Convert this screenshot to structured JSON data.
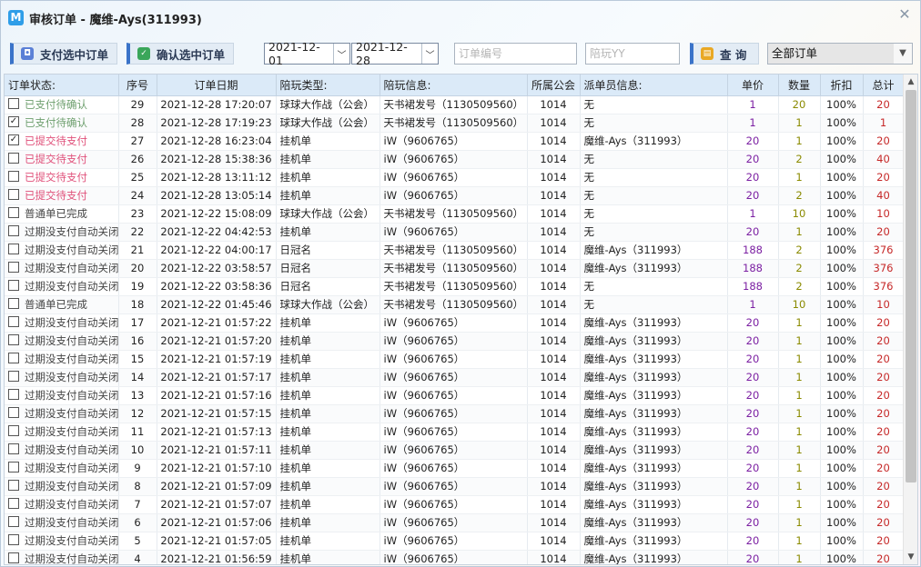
{
  "window": {
    "title": "审核订单 - 魔维-Ays(311993)",
    "app_icon": "M",
    "close_label": "✕"
  },
  "toolbar": {
    "pay_button": "支付选中订单",
    "confirm_button": "确认选中订单",
    "start_date": "2021-12-01",
    "end_date": "2021-12-28",
    "order_no_placeholder": "订单编号",
    "yy_placeholder": "陪玩YY",
    "search_button": "查 询",
    "filter_value": "全部订单"
  },
  "colors": {
    "accent": "#3a73c9",
    "unit_price": "#7b1fa2",
    "quantity": "#8a8a00",
    "total": "#c62828",
    "pending_confirm": "#6fa06f",
    "pending_pay": "#e0507a"
  },
  "table": {
    "headers": [
      "订单状态:",
      "序号",
      "订单日期",
      "陪玩类型:",
      "陪玩信息:",
      "所属公会",
      "派单员信息:",
      "单价",
      "数量",
      "折扣",
      "总计"
    ],
    "rows": [
      {
        "checked": false,
        "status": "已支付待确认",
        "status_color": "#6fa06f",
        "seq": "29",
        "date": "2021-12-28 17:20:07",
        "type": "球球大作战（公会）",
        "info": "天书裙发号（1130509560）",
        "guild": "1014",
        "dispatcher": "无",
        "price": "1",
        "qty": "20",
        "discount": "100%",
        "total": "20"
      },
      {
        "checked": true,
        "status": "已支付待确认",
        "status_color": "#6fa06f",
        "seq": "28",
        "date": "2021-12-28 17:19:23",
        "type": "球球大作战（公会）",
        "info": "天书裙发号（1130509560）",
        "guild": "1014",
        "dispatcher": "无",
        "price": "1",
        "qty": "1",
        "discount": "100%",
        "total": "1"
      },
      {
        "checked": true,
        "status": "已提交待支付",
        "status_color": "#e0507a",
        "seq": "27",
        "date": "2021-12-28 16:23:04",
        "type": "挂机单",
        "info": "iW（9606765）",
        "guild": "1014",
        "dispatcher": "魔维-Ays（311993）",
        "price": "20",
        "qty": "1",
        "discount": "100%",
        "total": "20"
      },
      {
        "checked": false,
        "status": "已提交待支付",
        "status_color": "#e0507a",
        "seq": "26",
        "date": "2021-12-28 15:38:36",
        "type": "挂机单",
        "info": "iW（9606765）",
        "guild": "1014",
        "dispatcher": "无",
        "price": "20",
        "qty": "2",
        "discount": "100%",
        "total": "40"
      },
      {
        "checked": false,
        "status": "已提交待支付",
        "status_color": "#e0507a",
        "seq": "25",
        "date": "2021-12-28 13:11:12",
        "type": "挂机单",
        "info": "iW（9606765）",
        "guild": "1014",
        "dispatcher": "无",
        "price": "20",
        "qty": "1",
        "discount": "100%",
        "total": "20"
      },
      {
        "checked": false,
        "status": "已提交待支付",
        "status_color": "#e0507a",
        "seq": "24",
        "date": "2021-12-28 13:05:14",
        "type": "挂机单",
        "info": "iW（9606765）",
        "guild": "1014",
        "dispatcher": "无",
        "price": "20",
        "qty": "2",
        "discount": "100%",
        "total": "40"
      },
      {
        "checked": false,
        "status": "普通单已完成",
        "status_color": "#444444",
        "seq": "23",
        "date": "2021-12-22 15:08:09",
        "type": "球球大作战（公会）",
        "info": "天书裙发号（1130509560）",
        "guild": "1014",
        "dispatcher": "无",
        "price": "1",
        "qty": "10",
        "discount": "100%",
        "total": "10"
      },
      {
        "checked": false,
        "status": "过期没支付自动关闭",
        "status_color": "#444444",
        "seq": "22",
        "date": "2021-12-22 04:42:53",
        "type": "挂机单",
        "info": "iW（9606765）",
        "guild": "1014",
        "dispatcher": "无",
        "price": "20",
        "qty": "1",
        "discount": "100%",
        "total": "20"
      },
      {
        "checked": false,
        "status": "过期没支付自动关闭",
        "status_color": "#444444",
        "seq": "21",
        "date": "2021-12-22 04:00:17",
        "type": "日冠名",
        "info": "天书裙发号（1130509560）",
        "guild": "1014",
        "dispatcher": "魔维-Ays（311993）",
        "price": "188",
        "qty": "2",
        "discount": "100%",
        "total": "376"
      },
      {
        "checked": false,
        "status": "过期没支付自动关闭",
        "status_color": "#444444",
        "seq": "20",
        "date": "2021-12-22 03:58:57",
        "type": "日冠名",
        "info": "天书裙发号（1130509560）",
        "guild": "1014",
        "dispatcher": "魔维-Ays（311993）",
        "price": "188",
        "qty": "2",
        "discount": "100%",
        "total": "376"
      },
      {
        "checked": false,
        "status": "过期没支付自动关闭",
        "status_color": "#444444",
        "seq": "19",
        "date": "2021-12-22 03:58:36",
        "type": "日冠名",
        "info": "天书裙发号（1130509560）",
        "guild": "1014",
        "dispatcher": "无",
        "price": "188",
        "qty": "2",
        "discount": "100%",
        "total": "376"
      },
      {
        "checked": false,
        "status": "普通单已完成",
        "status_color": "#444444",
        "seq": "18",
        "date": "2021-12-22 01:45:46",
        "type": "球球大作战（公会）",
        "info": "天书裙发号（1130509560）",
        "guild": "1014",
        "dispatcher": "无",
        "price": "1",
        "qty": "10",
        "discount": "100%",
        "total": "10"
      },
      {
        "checked": false,
        "status": "过期没支付自动关闭",
        "status_color": "#444444",
        "seq": "17",
        "date": "2021-12-21 01:57:22",
        "type": "挂机单",
        "info": "iW（9606765）",
        "guild": "1014",
        "dispatcher": "魔维-Ays（311993）",
        "price": "20",
        "qty": "1",
        "discount": "100%",
        "total": "20"
      },
      {
        "checked": false,
        "status": "过期没支付自动关闭",
        "status_color": "#444444",
        "seq": "16",
        "date": "2021-12-21 01:57:20",
        "type": "挂机单",
        "info": "iW（9606765）",
        "guild": "1014",
        "dispatcher": "魔维-Ays（311993）",
        "price": "20",
        "qty": "1",
        "discount": "100%",
        "total": "20"
      },
      {
        "checked": false,
        "status": "过期没支付自动关闭",
        "status_color": "#444444",
        "seq": "15",
        "date": "2021-12-21 01:57:19",
        "type": "挂机单",
        "info": "iW（9606765）",
        "guild": "1014",
        "dispatcher": "魔维-Ays（311993）",
        "price": "20",
        "qty": "1",
        "discount": "100%",
        "total": "20"
      },
      {
        "checked": false,
        "status": "过期没支付自动关闭",
        "status_color": "#444444",
        "seq": "14",
        "date": "2021-12-21 01:57:17",
        "type": "挂机单",
        "info": "iW（9606765）",
        "guild": "1014",
        "dispatcher": "魔维-Ays（311993）",
        "price": "20",
        "qty": "1",
        "discount": "100%",
        "total": "20"
      },
      {
        "checked": false,
        "status": "过期没支付自动关闭",
        "status_color": "#444444",
        "seq": "13",
        "date": "2021-12-21 01:57:16",
        "type": "挂机单",
        "info": "iW（9606765）",
        "guild": "1014",
        "dispatcher": "魔维-Ays（311993）",
        "price": "20",
        "qty": "1",
        "discount": "100%",
        "total": "20"
      },
      {
        "checked": false,
        "status": "过期没支付自动关闭",
        "status_color": "#444444",
        "seq": "12",
        "date": "2021-12-21 01:57:15",
        "type": "挂机单",
        "info": "iW（9606765）",
        "guild": "1014",
        "dispatcher": "魔维-Ays（311993）",
        "price": "20",
        "qty": "1",
        "discount": "100%",
        "total": "20"
      },
      {
        "checked": false,
        "status": "过期没支付自动关闭",
        "status_color": "#444444",
        "seq": "11",
        "date": "2021-12-21 01:57:13",
        "type": "挂机单",
        "info": "iW（9606765）",
        "guild": "1014",
        "dispatcher": "魔维-Ays（311993）",
        "price": "20",
        "qty": "1",
        "discount": "100%",
        "total": "20"
      },
      {
        "checked": false,
        "status": "过期没支付自动关闭",
        "status_color": "#444444",
        "seq": "10",
        "date": "2021-12-21 01:57:11",
        "type": "挂机单",
        "info": "iW（9606765）",
        "guild": "1014",
        "dispatcher": "魔维-Ays（311993）",
        "price": "20",
        "qty": "1",
        "discount": "100%",
        "total": "20"
      },
      {
        "checked": false,
        "status": "过期没支付自动关闭",
        "status_color": "#444444",
        "seq": "9",
        "date": "2021-12-21 01:57:10",
        "type": "挂机单",
        "info": "iW（9606765）",
        "guild": "1014",
        "dispatcher": "魔维-Ays（311993）",
        "price": "20",
        "qty": "1",
        "discount": "100%",
        "total": "20"
      },
      {
        "checked": false,
        "status": "过期没支付自动关闭",
        "status_color": "#444444",
        "seq": "8",
        "date": "2021-12-21 01:57:09",
        "type": "挂机单",
        "info": "iW（9606765）",
        "guild": "1014",
        "dispatcher": "魔维-Ays（311993）",
        "price": "20",
        "qty": "1",
        "discount": "100%",
        "total": "20"
      },
      {
        "checked": false,
        "status": "过期没支付自动关闭",
        "status_color": "#444444",
        "seq": "7",
        "date": "2021-12-21 01:57:07",
        "type": "挂机单",
        "info": "iW（9606765）",
        "guild": "1014",
        "dispatcher": "魔维-Ays（311993）",
        "price": "20",
        "qty": "1",
        "discount": "100%",
        "total": "20"
      },
      {
        "checked": false,
        "status": "过期没支付自动关闭",
        "status_color": "#444444",
        "seq": "6",
        "date": "2021-12-21 01:57:06",
        "type": "挂机单",
        "info": "iW（9606765）",
        "guild": "1014",
        "dispatcher": "魔维-Ays（311993）",
        "price": "20",
        "qty": "1",
        "discount": "100%",
        "total": "20"
      },
      {
        "checked": false,
        "status": "过期没支付自动关闭",
        "status_color": "#444444",
        "seq": "5",
        "date": "2021-12-21 01:57:05",
        "type": "挂机单",
        "info": "iW（9606765）",
        "guild": "1014",
        "dispatcher": "魔维-Ays（311993）",
        "price": "20",
        "qty": "1",
        "discount": "100%",
        "total": "20"
      },
      {
        "checked": false,
        "status": "过期没支付自动关闭",
        "status_color": "#444444",
        "seq": "4",
        "date": "2021-12-21 01:56:59",
        "type": "挂机单",
        "info": "iW（9606765）",
        "guild": "1014",
        "dispatcher": "魔维-Ays（311993）",
        "price": "20",
        "qty": "1",
        "discount": "100%",
        "total": "20"
      }
    ]
  }
}
